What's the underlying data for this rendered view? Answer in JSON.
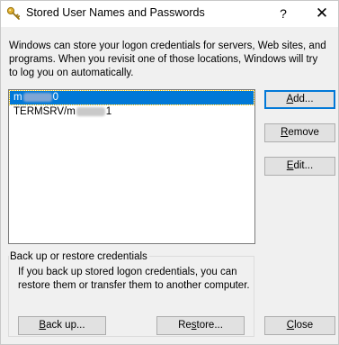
{
  "window": {
    "title": "Stored User Names and Passwords",
    "help_glyph": "?",
    "close_glyph": "✕",
    "title_icon": "key-icon"
  },
  "intro_text": "Windows can store your logon credentials for servers, Web sites, and programs. When you revisit one of those locations, Windows will try to log you on automatically.",
  "credentials": {
    "items": [
      {
        "prefix": "m",
        "suffix": "0",
        "selected": true
      },
      {
        "prefix": "TERMSRV/m",
        "suffix": "1",
        "selected": false
      }
    ]
  },
  "buttons": {
    "add": {
      "pre": "",
      "key": "A",
      "post": "dd..."
    },
    "remove": {
      "pre": "",
      "key": "R",
      "post": "emove"
    },
    "edit": {
      "pre": "",
      "key": "E",
      "post": "dit..."
    },
    "backup": {
      "pre": "",
      "key": "B",
      "post": "ack up..."
    },
    "restore": {
      "pre": "Re",
      "key": "s",
      "post": "tore..."
    },
    "close": {
      "pre": "",
      "key": "C",
      "post": "lose"
    }
  },
  "backup_group": {
    "title": "Back up or restore credentials",
    "text": "If you back up stored logon credentials, you can restore them or transfer them to another computer."
  },
  "colors": {
    "accent": "#0078d7",
    "window_bg": "#f0f0f0",
    "key_icon": "#d4a017"
  }
}
